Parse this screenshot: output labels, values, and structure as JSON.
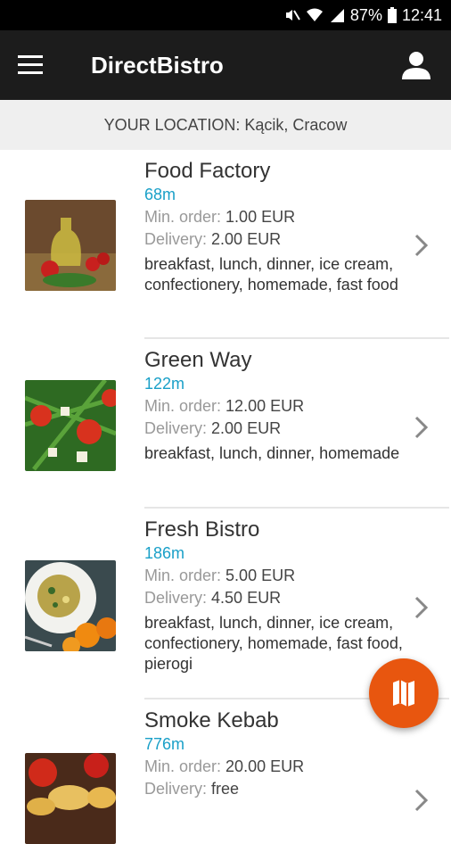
{
  "status": {
    "battery": "87%",
    "time": "12:41"
  },
  "header": {
    "title": "DirectBistro"
  },
  "location": {
    "text": "YOUR LOCATION: Kącik, Cracow"
  },
  "labels": {
    "min_order": "Min. order:",
    "delivery": "Delivery:"
  },
  "restaurants": [
    {
      "name": "Food Factory",
      "distance": "68m",
      "min_order": "1.00 EUR",
      "delivery": "2.00 EUR",
      "tags": "breakfast, lunch, dinner, ice cream, confectionery, homemade, fast food"
    },
    {
      "name": "Green Way",
      "distance": "122m",
      "min_order": "12.00 EUR",
      "delivery": "2.00 EUR",
      "tags": "breakfast, lunch, dinner, homemade"
    },
    {
      "name": "Fresh Bistro",
      "distance": "186m",
      "min_order": "5.00 EUR",
      "delivery": "4.50 EUR",
      "tags": "breakfast, lunch, dinner, ice cream, confectionery, homemade, fast food, pierogi"
    },
    {
      "name": "Smoke Kebab",
      "distance": "776m",
      "min_order": "20.00 EUR",
      "delivery": "free",
      "tags": ""
    }
  ],
  "icons": {
    "menu": "hamburger-menu-icon",
    "user": "user-icon",
    "chevron": "chevron-right-icon",
    "fab": "map-icon"
  },
  "colors": {
    "accent": "#1aa0c8",
    "fab": "#e8560f",
    "appbar": "#1c1c1c"
  }
}
